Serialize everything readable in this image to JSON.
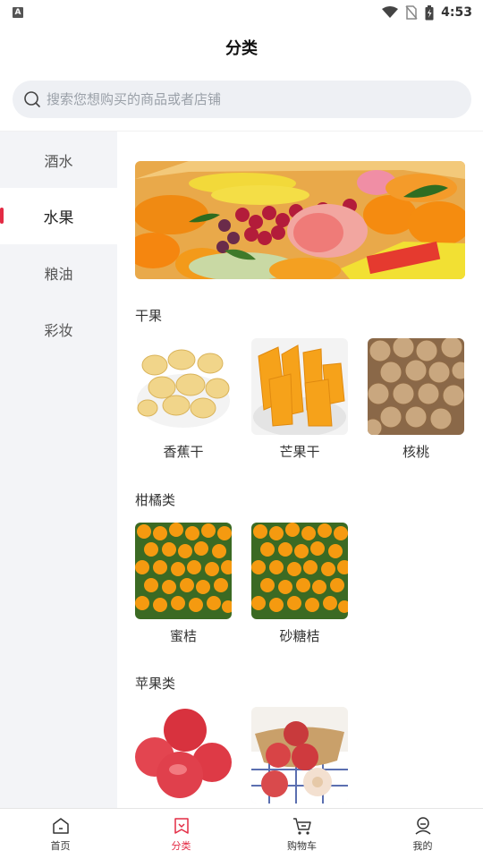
{
  "status_bar": {
    "time": "4:53",
    "left_icon": "A"
  },
  "header": {
    "title": "分类"
  },
  "search": {
    "placeholder": "搜索您想购买的商品或者店铺"
  },
  "sidebar": {
    "items": [
      {
        "label": "酒水"
      },
      {
        "label": "水果"
      },
      {
        "label": "粮油"
      },
      {
        "label": "彩妆"
      }
    ],
    "active_index": 1
  },
  "sections": [
    {
      "title": "干果",
      "products": [
        {
          "name": "香蕉干"
        },
        {
          "name": "芒果干"
        },
        {
          "name": "核桃"
        }
      ]
    },
    {
      "title": "柑橘类",
      "products": [
        {
          "name": "蜜桔"
        },
        {
          "name": "砂糖桔"
        }
      ]
    },
    {
      "title": "苹果类",
      "products": []
    }
  ],
  "tab_bar": {
    "tabs": [
      {
        "label": "首页",
        "icon": "home-icon"
      },
      {
        "label": "分类",
        "icon": "category-icon"
      },
      {
        "label": "购物车",
        "icon": "cart-icon"
      },
      {
        "label": "我的",
        "icon": "profile-icon"
      }
    ],
    "active_index": 1
  },
  "colors": {
    "accent": "#e32b44",
    "sidebar_bg": "#f3f4f7",
    "search_bg": "#eef0f4"
  }
}
